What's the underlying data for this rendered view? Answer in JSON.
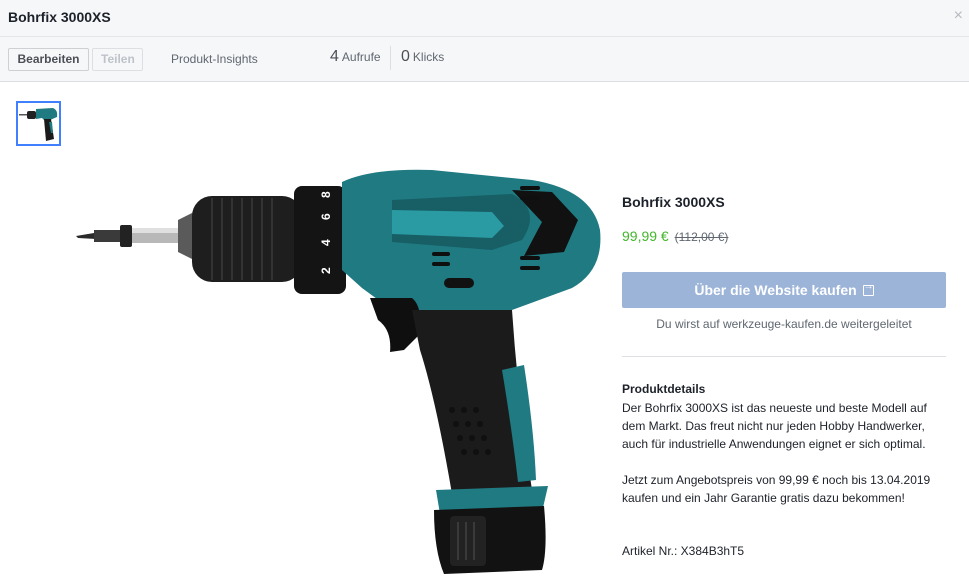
{
  "header": {
    "title": "Bohrfix 3000XS",
    "close_glyph": "×"
  },
  "toolbar": {
    "edit_label": "Bearbeiten",
    "share_label": "Teilen",
    "insights_label": "Produkt-Insights",
    "views_count": "4",
    "views_label": "Aufrufe",
    "clicks_count": "0",
    "clicks_label": "Klicks"
  },
  "gallery": {
    "thumbnail_icon": "drill-thumbnail",
    "chuck_numbers": [
      "8",
      "6",
      "4",
      "2"
    ]
  },
  "product": {
    "name": "Bohrfix 3000XS",
    "price": "99,99 €",
    "old_price": "(112,00 €)",
    "buy_label": "Über die Website kaufen",
    "redirect_note": "Du wirst auf werkzeuge-kaufen.de weitergeleitet",
    "details_heading": "Produktdetails",
    "details_paragraph_1": "Der Bohrfix 3000XS ist das neueste und beste Modell auf dem Markt. Das freut nicht nur jeden Hobby Handwerker, auch für industrielle Anwendungen eignet er sich optimal.",
    "details_paragraph_2": "Jetzt zum Angebotspreis von 99,99 € noch bis 13.04.2019 kaufen und ein Jahr Garantie gratis dazu bekommen!",
    "article_number": "Artikel Nr.: X384B3hT5"
  },
  "colors": {
    "accent": "#4080ff",
    "price_green": "#42b72a",
    "button_disabled_blue": "#9cb4d8",
    "drill_teal": "#1f7a82"
  }
}
